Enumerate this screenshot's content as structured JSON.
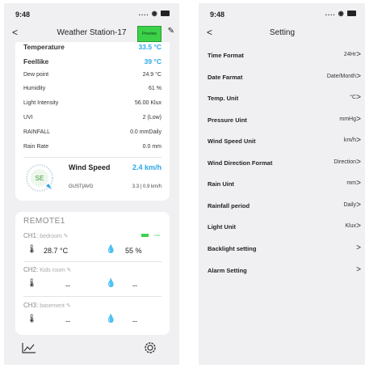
{
  "left": {
    "status": {
      "time": "9:48",
      "signal": "....",
      "wifi": "◠"
    },
    "nav": {
      "back": "<",
      "title": "Weather Station-17",
      "preview": "Preview",
      "edit_icon": "edit-icon"
    },
    "rows": [
      {
        "label": "Temperature",
        "value": "33.5 °C"
      },
      {
        "label": "Feellike",
        "value": "39 °C"
      },
      {
        "label": "Dew point",
        "value": "24.9 °C"
      },
      {
        "label": "Humidity",
        "value": "61 %"
      },
      {
        "label": "Light Intensity",
        "value": "56.00 Klux"
      },
      {
        "label": "UVI",
        "value": "2 (Low)"
      },
      {
        "label": "RAINFALL",
        "value": "0.0 mmDaily"
      },
      {
        "label": "Rain Rate",
        "value": "0.0 mm"
      }
    ],
    "wind": {
      "compass": "SE",
      "label": "Wind Speed",
      "value": "2.4 km/h",
      "gust_label": "GUST|AVG",
      "gust_value": "3.3 | 0.9 km/h"
    },
    "remote": {
      "title": "REMOTE1",
      "channels": [
        {
          "name": "CH1:",
          "room": "bedroom",
          "temp": "28.7 °C",
          "hum": "55 %",
          "battery": "Low"
        },
        {
          "name": "CH2:",
          "room": "Kids room",
          "temp": "--",
          "hum": "--"
        },
        {
          "name": "CH3:",
          "room": "basement",
          "temp": "--",
          "hum": "--"
        }
      ]
    },
    "colors": {
      "accent": "#2aa8e8",
      "battery": "#3bd24a"
    }
  },
  "right": {
    "status": {
      "time": "9:48"
    },
    "nav": {
      "back": "<",
      "title": "Setting"
    },
    "settings": [
      {
        "label": "Time Format",
        "value": "24Hr"
      },
      {
        "label": "Date Farmat",
        "value": "Date/Month"
      },
      {
        "label": "Temp. Unit",
        "value": "°C"
      },
      {
        "label": "Pressure Uint",
        "value": "mmHg"
      },
      {
        "label": "Wind Speed Unit",
        "value": "km/h"
      },
      {
        "label": "Wind Direction Format",
        "value": "Direction"
      },
      {
        "label": "Rain Uint",
        "value": "mm"
      },
      {
        "label": "Rainfall period",
        "value": "Daily"
      },
      {
        "label": "Light Unit",
        "value": "Klux"
      },
      {
        "label": "Backlight setting",
        "value": ""
      },
      {
        "label": "Alarm Setting",
        "value": ""
      }
    ],
    "chevron": ">"
  }
}
